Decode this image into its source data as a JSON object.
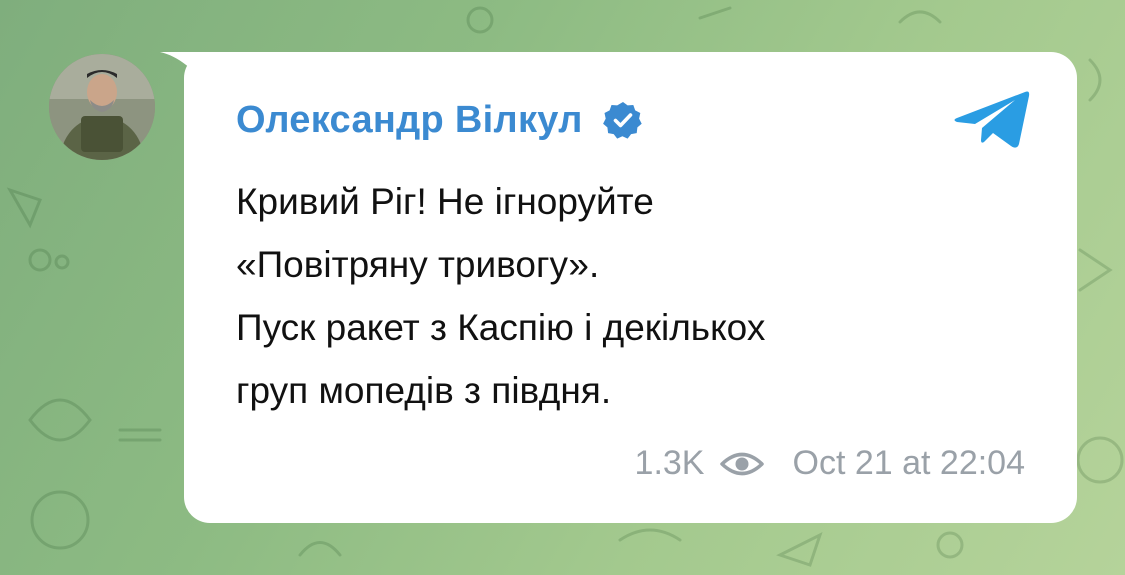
{
  "post": {
    "author": "Олександр Вілкул",
    "message_lines": [
      "Кривий Ріг! Не ігноруйте",
      "«Повітряну тривогу».",
      "Пуск ракет з Каспію і декількох",
      "груп мопедів з півдня."
    ],
    "views": "1.3K",
    "timestamp": "Oct 21 at 22:04",
    "icons": {
      "verified": "verified-badge-icon",
      "app": "telegram-logo-icon",
      "views": "eye-icon"
    }
  },
  "colors": {
    "author": "#3b8ad1",
    "verified_badge": "#3b8ad1",
    "telegram": "#2a9de3",
    "meta": "#9aa1a8",
    "background": "#8dbb83"
  }
}
